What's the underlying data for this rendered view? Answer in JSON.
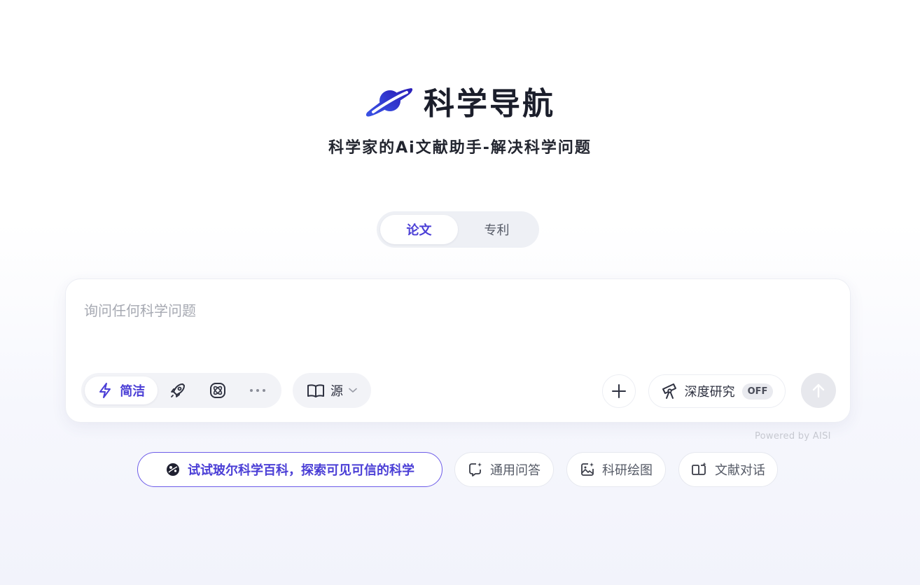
{
  "brand": {
    "title": "科学导航",
    "tagline": "科学家的Ai文献助手-解决科学问题",
    "logo_icon": "planet-ring-icon",
    "logo_color": "#3a3fd6"
  },
  "tabs": [
    {
      "label": "论文",
      "active": true
    },
    {
      "label": "专利",
      "active": false
    }
  ],
  "search": {
    "placeholder": "询问任何科学问题",
    "value": ""
  },
  "modes": {
    "active_label": "简洁",
    "active_icon": "lightning-icon",
    "other_icons": [
      "rocket-icon",
      "atom-icon",
      "more-icon"
    ]
  },
  "source": {
    "label": "源",
    "icon": "book-icon"
  },
  "deep_research": {
    "label": "深度研究",
    "status": "OFF",
    "icon": "telescope-icon"
  },
  "footer": {
    "powered_by": "Powered by AISI"
  },
  "chips": [
    {
      "label": "试试玻尔科学百科，探索可见可信的科学",
      "icon": "science-globe-icon",
      "primary": true
    },
    {
      "label": "通用问答",
      "icon": "chat-spark-icon"
    },
    {
      "label": "科研绘图",
      "icon": "image-spark-icon"
    },
    {
      "label": "文献对话",
      "icon": "doc-spark-icon"
    }
  ],
  "colors": {
    "accent": "#4b3fd6",
    "accent_border": "#6d5ce8",
    "muted": "#a6a9b2"
  }
}
